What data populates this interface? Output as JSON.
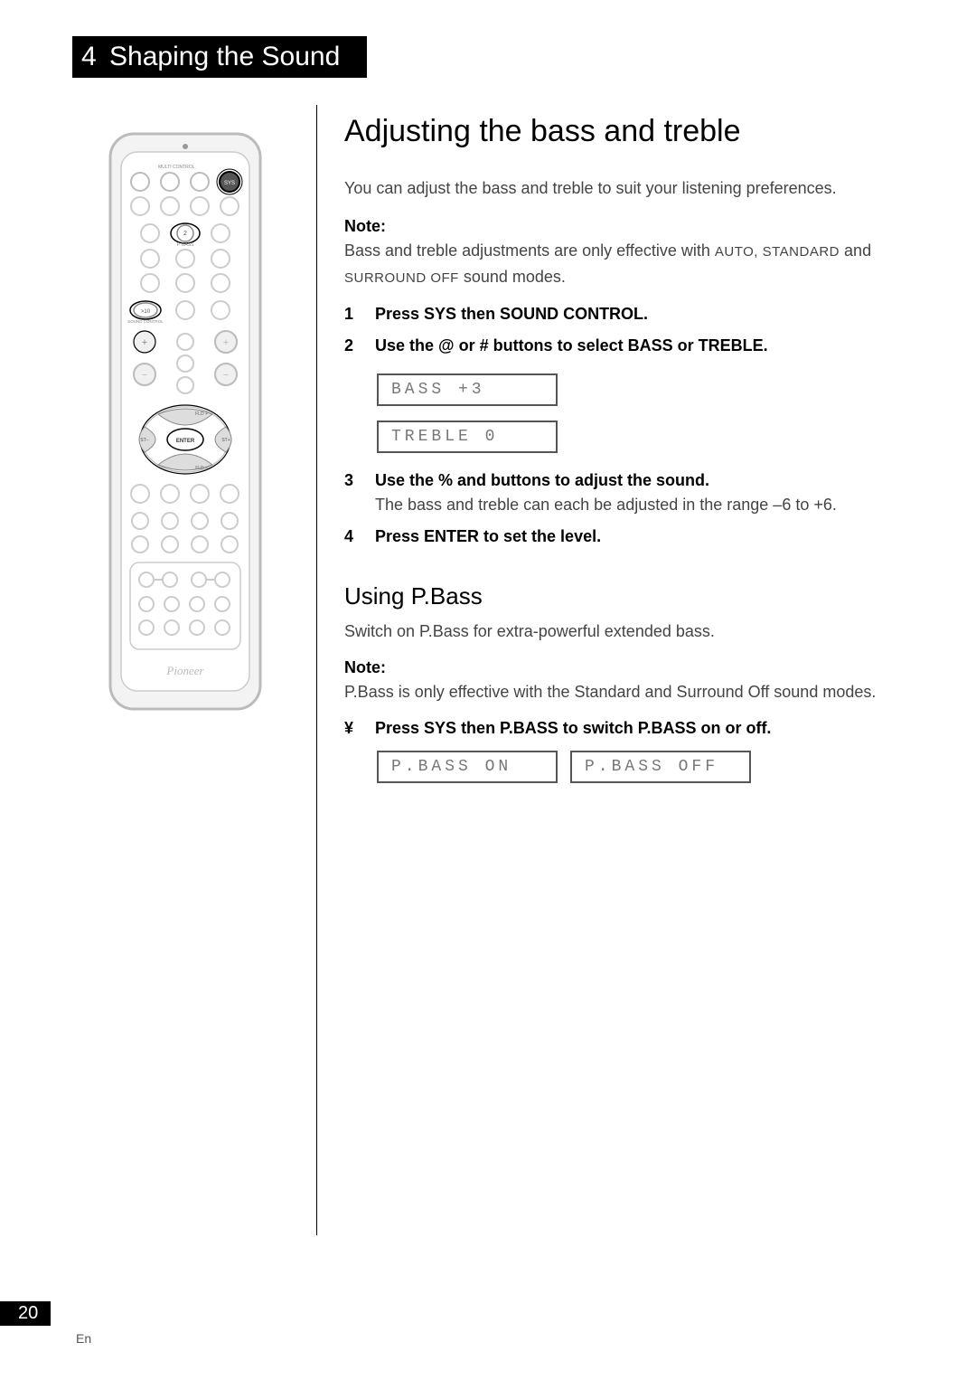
{
  "chapter": {
    "number": "4",
    "title": "Shaping the Sound"
  },
  "main": {
    "heading": "Adjusting the bass and treble",
    "intro": "You can adjust the bass and treble to suit your listening preferences.",
    "note1_label": "Note:",
    "note1_text_before": "Bass and treble adjustments are only effective with ",
    "note1_modes1": "AUTO, STANDARD",
    "note1_text_mid": " and ",
    "note1_modes2": "SURROUND OFF",
    "note1_text_after": " sound modes.",
    "steps": [
      {
        "num": "1",
        "bold": "Press SYS then SOUND CONTROL."
      },
      {
        "num": "2",
        "bold": "Use the @ or # buttons to select BASS or TREBLE."
      },
      {
        "num": "3",
        "bold": "Use the % and  buttons to adjust the sound.",
        "sub": "The bass and treble can each be adjusted in the range –6 to +6."
      },
      {
        "num": "4",
        "bold": "Press ENTER to set the level."
      }
    ],
    "display1": "BASS  +3",
    "display2": "TREBLE 0",
    "sub_heading": "Using P.Bass",
    "pbass_intro": "Switch on P.Bass for extra-powerful extended bass.",
    "note2_label": "Note:",
    "note2_text": "P.Bass is only effective with the Standard and Surround Off sound modes.",
    "pbass_step_bullet": "¥",
    "pbass_step": "Press SYS then P.BASS to switch P.BASS on or off.",
    "display_pbass_on": "P.BASS ON",
    "display_pbass_off": "P.BASS OFF"
  },
  "remote": {
    "labels": {
      "multi_control": "MULTI CONTROL",
      "sys": "SYS",
      "button2": "2",
      "pbass": "P. BASS",
      "gt10": ">10",
      "sound_control": "SOUND CONTROL",
      "enter": "ENTER",
      "st_minus": "ST–",
      "st_plus": "ST+",
      "fld_plus": "FLD +",
      "fld_minus": "FLD –",
      "brand": "Pioneer"
    }
  },
  "footer": {
    "page": "20",
    "lang": "En"
  }
}
